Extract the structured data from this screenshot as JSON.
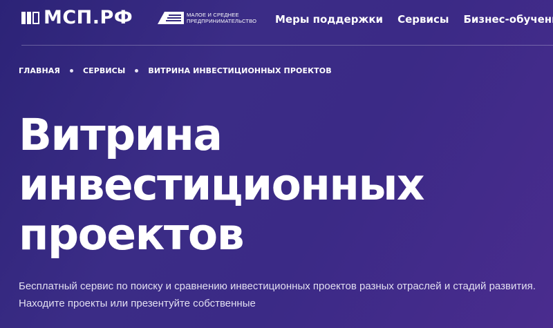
{
  "brand": {
    "logo_text": "МСП.РФ",
    "badge_text": "МАЛОЕ И СРЕДНЕЕ ПРЕДПРИНИМАТЕЛЬСТВО"
  },
  "nav": {
    "items": [
      "Меры поддержки",
      "Сервисы",
      "Бизнес-обучение"
    ]
  },
  "breadcrumb": [
    "ГЛАВНАЯ",
    "СЕРВИСЫ",
    "ВИТРИНА ИНВЕСТИЦИОННЫХ ПРОЕКТОВ"
  ],
  "hero": {
    "title_lines": [
      "Витрина",
      "инвестиционных",
      "проектов"
    ],
    "description": "Бесплатный сервис по поиску и сравнению инвестиционных проектов разных отраслей и стадий развития. Находите проекты или презентуйте собственные"
  },
  "colors": {
    "background_start": "#2c2377",
    "background_end": "#4a2c8e",
    "text": "#ffffff"
  }
}
